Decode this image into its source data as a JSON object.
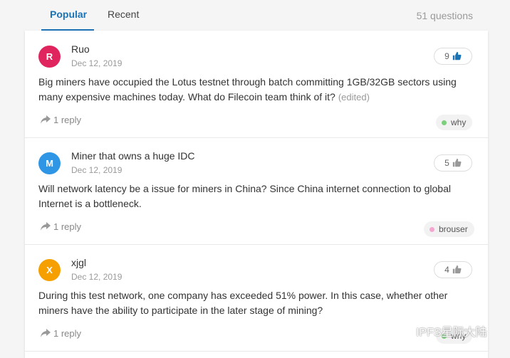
{
  "tabs": [
    {
      "label": "Popular"
    },
    {
      "label": "Recent"
    }
  ],
  "question_count": "51 questions",
  "questions": [
    {
      "avatar_letter": "R",
      "avatar_color": "#e0245e",
      "author": "Ruo",
      "date": "Dec 12, 2019",
      "text": "Big miners have occupied the Lotus testnet through batch committing 1GB/32GB sectors using many expensive machines today. What do Filecoin team think of it?",
      "edited": "(edited)",
      "likes": "9",
      "liked": true,
      "replies": "1 reply",
      "tag": "why",
      "tag_color": "#7ccf7c"
    },
    {
      "avatar_letter": "M",
      "avatar_color": "#2f96e6",
      "author": "Miner that owns a huge IDC",
      "date": "Dec 12, 2019",
      "text": "Will network latency be a issue for miners in China? Since China internet connection to global Internet is a bottleneck.",
      "likes": "5",
      "liked": false,
      "replies": "1 reply",
      "tag": "brouser",
      "tag_color": "#f4a6d0"
    },
    {
      "avatar_letter": "X",
      "avatar_color": "#f5a000",
      "author": "xjgl",
      "date": "Dec 12, 2019",
      "text": "During this test network, one company has exceeded 51% power. In this case, whether other miners have the ability to participate in the later stage of mining?",
      "likes": "4",
      "liked": false,
      "replies": "1 reply",
      "tag": "why",
      "tag_color": "#7ccf7c"
    }
  ],
  "watermark": "IPFS星际大陆"
}
